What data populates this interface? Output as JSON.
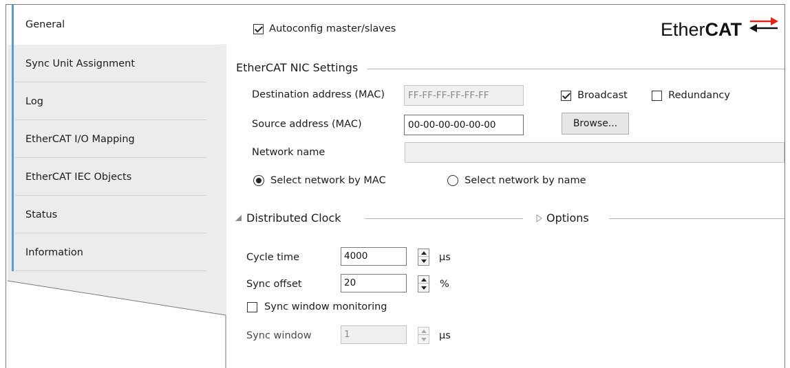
{
  "sidebar": {
    "tabs": [
      {
        "label": "General",
        "active": true
      },
      {
        "label": "Sync Unit Assignment"
      },
      {
        "label": "Log"
      },
      {
        "label": "EtherCAT I/O Mapping"
      },
      {
        "label": "EtherCAT IEC Objects"
      },
      {
        "label": "Status"
      },
      {
        "label": "Information"
      }
    ]
  },
  "general": {
    "autoconfig_label": "Autoconfig master/slaves",
    "autoconfig_checked": true,
    "logo_text_light": "Ether",
    "logo_text_bold": "CAT",
    "logo_accent": "#e2231a"
  },
  "nic": {
    "title": "EtherCAT NIC Settings",
    "dest_label": "Destination address (MAC)",
    "dest_value": "FF-FF-FF-FF-FF-FF",
    "broadcast_label": "Broadcast",
    "broadcast_checked": true,
    "redundancy_label": "Redundancy",
    "redundancy_checked": false,
    "source_label": "Source address (MAC)",
    "source_value": "00-00-00-00-00-00",
    "browse_label": "Browse...",
    "network_name_label": "Network name",
    "network_name_value": "",
    "radio_mac_label": "Select network by MAC",
    "radio_name_label": "Select network by name",
    "selected": "mac"
  },
  "clock": {
    "title": "Distributed Clock",
    "options_title": "Options",
    "cycle_label": "Cycle time",
    "cycle_value": "4000",
    "cycle_unit": "µs",
    "offset_label": "Sync offset",
    "offset_value": "20",
    "offset_unit": "%",
    "monitoring_label": "Sync window monitoring",
    "monitoring_checked": false,
    "window_label": "Sync window",
    "window_value": "1",
    "window_unit": "µs"
  }
}
